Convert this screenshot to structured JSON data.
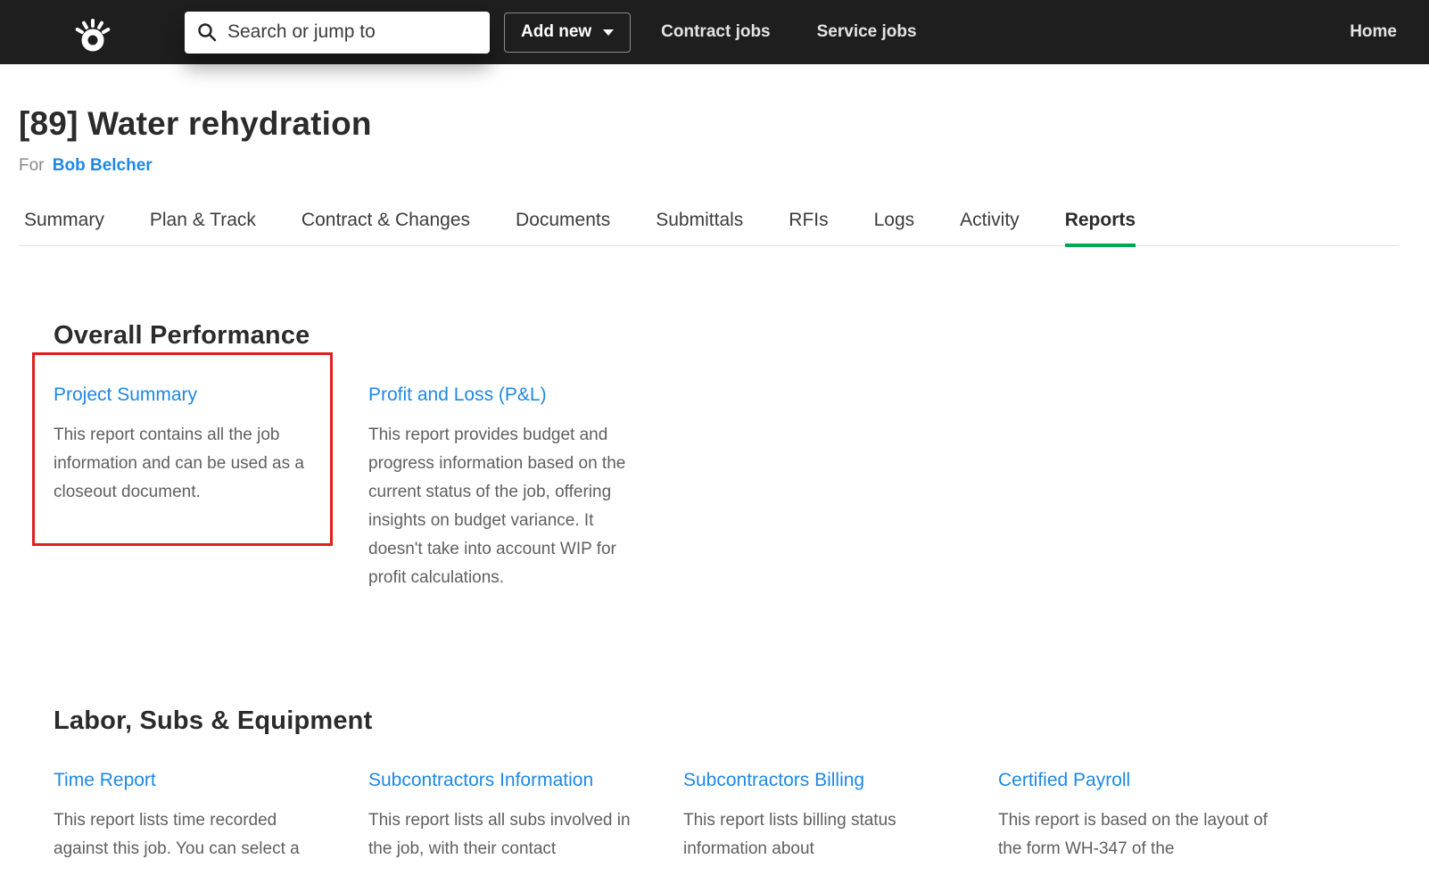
{
  "navbar": {
    "logo_name": "knowify-logo",
    "search_placeholder": "Search or jump to",
    "add_new_label": "Add new",
    "links": [
      {
        "label": "Contract jobs"
      },
      {
        "label": "Service jobs"
      }
    ],
    "home_label": "Home"
  },
  "header": {
    "title": "[89] Water rehydration",
    "for_prefix": "For",
    "customer": "Bob Belcher"
  },
  "active_tab": "Reports",
  "tabs": [
    {
      "label": "Summary",
      "active": false
    },
    {
      "label": "Plan & Track",
      "active": false
    },
    {
      "label": "Contract & Changes",
      "active": false
    },
    {
      "label": "Documents",
      "active": false
    },
    {
      "label": "Submittals",
      "active": false
    },
    {
      "label": "RFIs",
      "active": false
    },
    {
      "label": "Logs",
      "active": false
    },
    {
      "label": "Activity",
      "active": false
    },
    {
      "label": "Reports",
      "active": true
    }
  ],
  "sections": [
    {
      "title": "Overall Performance",
      "reports": [
        {
          "title": "Project Summary",
          "description": "This report contains all the job information and can be used as a closeout document.",
          "highlighted": true
        },
        {
          "title": "Profit and Loss (P&L)",
          "description": "This report provides budget and progress information based on the current status of the job, offering insights on budget variance. It doesn't take into account WIP for profit calculations.",
          "highlighted": false
        }
      ]
    },
    {
      "title": "Labor, Subs & Equipment",
      "reports": [
        {
          "title": "Time Report",
          "description": "This report lists time recorded against this job. You can select a",
          "highlighted": false
        },
        {
          "title": "Subcontractors Information",
          "description": "This report lists all subs involved in the job, with their contact",
          "highlighted": false
        },
        {
          "title": "Subcontractors Billing",
          "description": "This report lists billing status information about",
          "highlighted": false
        },
        {
          "title": "Certified Payroll",
          "description": "This report is based on the layout of the form WH-347 of the",
          "highlighted": false
        }
      ]
    }
  ],
  "colors": {
    "navbar_bg": "#1e1e1e",
    "link_blue": "#1e88e5",
    "accent_green": "#00a651",
    "annotation_red": "#e0201f"
  }
}
